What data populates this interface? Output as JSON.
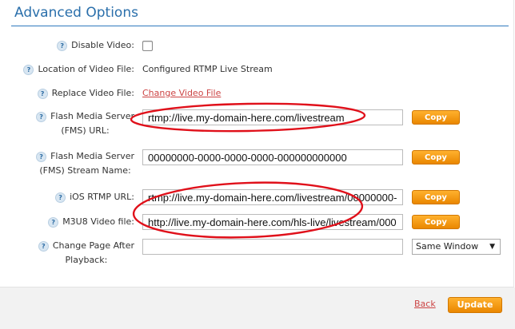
{
  "section": {
    "title": "Advanced Options"
  },
  "help_glyph": "?",
  "fields": {
    "disable_video": {
      "label": "Disable Video:",
      "checked": false
    },
    "location": {
      "label": "Location of Video File:",
      "value": "Configured RTMP Live Stream"
    },
    "replace": {
      "label": "Replace Video File:",
      "link": "Change Video File"
    },
    "fms_url": {
      "label_line1": "Flash Media Server",
      "label_line2": "(FMS) URL:",
      "value": "rtmp://live.my-domain-here.com/livestream",
      "copy": "Copy"
    },
    "fms_stream": {
      "label_line1": "Flash Media Server",
      "label_line2": "(FMS) Stream Name:",
      "value": "00000000-0000-0000-0000-000000000000",
      "copy": "Copy"
    },
    "ios_rtmp": {
      "label": "iOS RTMP URL:",
      "value": "rtmp://live.my-domain-here.com/livestream/00000000-",
      "copy": "Copy"
    },
    "m3u8": {
      "label": "M3U8 Video file:",
      "value": "http://live.my-domain-here.com/hls-live/livestream/000",
      "copy": "Copy"
    },
    "change_page": {
      "label_line1": "Change Page After",
      "label_line2": "Playback:",
      "value": "",
      "select": "Same Window"
    }
  },
  "footer": {
    "back": "Back",
    "update": "Update"
  },
  "colors": {
    "accent": "#2f79be",
    "button": "#ef8f00",
    "annotation": "#e0101a",
    "link": "#cc4444"
  }
}
